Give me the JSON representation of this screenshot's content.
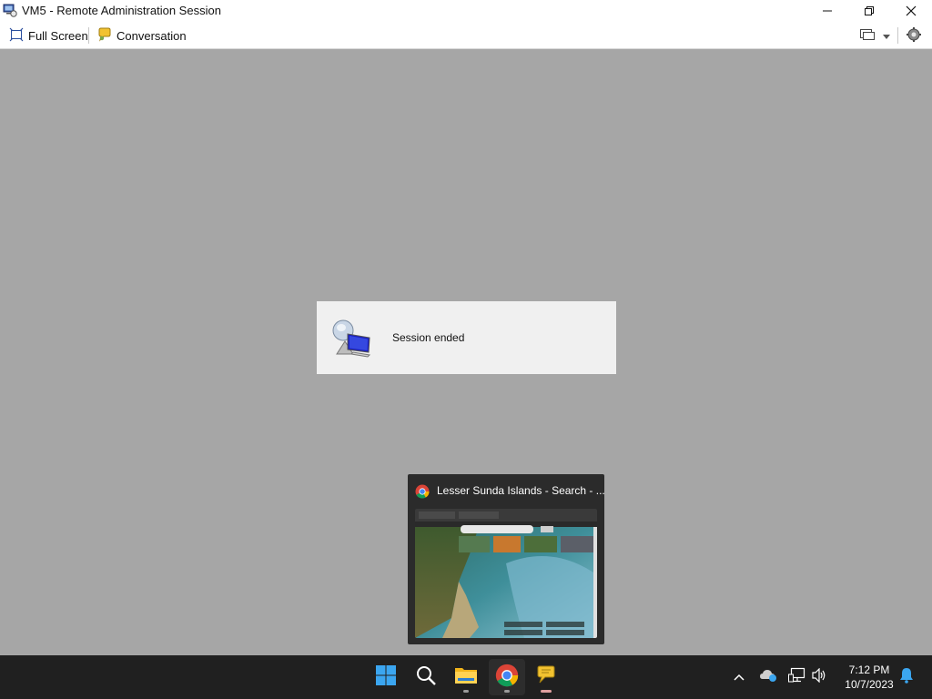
{
  "window": {
    "title": "VM5 - Remote Administration Session"
  },
  "toolbar": {
    "full_screen_label": "Full Screen",
    "conversation_label": "Conversation"
  },
  "dialog": {
    "message": "Session ended"
  },
  "preview": {
    "title": "Lesser Sunda Islands - Search - ..."
  },
  "taskbar": {
    "time": "7:12 PM",
    "date": "10/7/2023",
    "pinned": [
      "start-icon",
      "search-icon",
      "file-explorer-icon",
      "chrome-icon",
      "chat-icon"
    ]
  },
  "colors": {
    "background": "#a6a6a6",
    "dialog": "#f0f0f0",
    "taskbar": "#202020",
    "accent_blue": "#0078d4"
  }
}
